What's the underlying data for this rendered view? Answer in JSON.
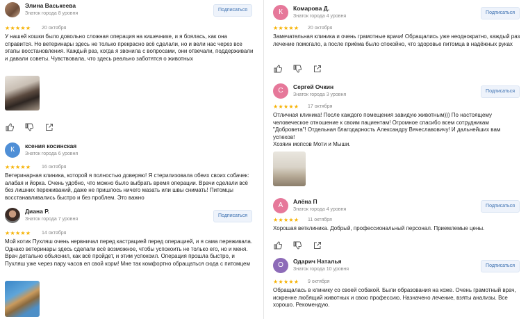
{
  "reviews_left": [
    {
      "name": "Элина Васькеева",
      "level": "Знаток города 8 уровня",
      "date": "20 октября",
      "subscribe": "Подписаться",
      "stars": "★★★★★",
      "text": [
        "У нашей кошки было довольно сложная операция на кишечнике, и я боялась, как она справится. Но ветеринары здесь не только прекрасно всё сделали, но и вели нас через все этапы восстановления. Каждый раз, когда я звонила с вопросами, они отвечали, поддерживали и давали советы. Чувствовала, что здесь реально заботятся о животных"
      ]
    },
    {
      "name": "ксения косинская",
      "initial": "К",
      "level": "Знаток города 6 уровня",
      "date": "16 октября",
      "stars": "★★★★★",
      "text": [
        "Ветеринарная клиника, которой я полностью доверяю! Я стерилизовала обеих своих собачек: алабая и йорка. Очень удобно, что можно было выбрать время операции. Врачи сделали всё без лишних переживаний, даже не пришлось ничего мазать или швы снимать! Питомцы восстанавливались быстро и без проблем. Это важно"
      ]
    },
    {
      "name": "Диана Р.",
      "level": "Знаток города 7 уровня",
      "date": "14 октября",
      "subscribe": "Подписаться",
      "stars": "★★★★★",
      "text": [
        "Мой котик Пухляш очень нервничал перед кастрацией перед операцией, и я сама переживала. Однако ветеринары здесь сделали всё возможное, чтобы успокоить не только его, но и меня. Врач детально объяснил, как всё пройдет, и этим успокоил. Операция прошла быстро, и Пухляш уже через пару часов ел свой корм! Мне так комфортно обращаться сюда с питомцем"
      ]
    }
  ],
  "reviews_right": [
    {
      "name": "Комарова Д.",
      "initial": "К",
      "level": "Знаток города 4 уровня",
      "date": "20 октября",
      "subscribe": "Подписаться",
      "stars": "★★★★★",
      "text": [
        "Замечательная клиника и очень грамотные врачи! Обращались уже неоднократно, каждый раз лечение помогало, а после приёма было спокойно, что здоровье питомца в надёжных руках"
      ]
    },
    {
      "name": "Сергей Очкин",
      "initial": "С",
      "level": "Знаток города 3 уровня",
      "date": "17 октября",
      "subscribe": "Подписаться",
      "stars": "★★★★★",
      "text": [
        "Отличная клиника! После каждого помещения завидую животным))) По настоящему человеческое отношение к своим пациентам! Огромное спасибо всем сотрудникам \"Добровета\"! Отдельная благодарность Александру Вячеславовичу! И дальнейших вам успехов!",
        "Хозяин мопсов Моти и Мыши."
      ]
    },
    {
      "name": "Алёна П",
      "initial": "А",
      "level": "Знаток города 4 уровня",
      "date": "11 октября",
      "subscribe": "Подписаться",
      "stars": "★★★★★",
      "text": [
        "Хорошая ветклиника. Добрый, профессиональный персонал. Приемлемые цены."
      ]
    },
    {
      "name": "Одарич Наталья",
      "initial": "О",
      "level": "Знаток города 10 уровня",
      "date": "9 октября",
      "subscribe": "Подписаться",
      "stars": "★★★★★",
      "text": [
        "Обращалась в клинику со своей собакой. Были образования на коже. Очень грамотный врач, искренне любящий животных и свою профессию. Назначено лечение, взяты анализы. Все хорошо. Рекомендую."
      ]
    }
  ],
  "colors": {
    "star": "#f6b100",
    "subscribe_text": "#3a6fb0",
    "avatar_pink": "#e6789a",
    "avatar_blue": "#4f8fd6",
    "avatar_violet": "#8d6bb8"
  },
  "icons": [
    "like-icon",
    "dislike-icon",
    "share-icon"
  ]
}
